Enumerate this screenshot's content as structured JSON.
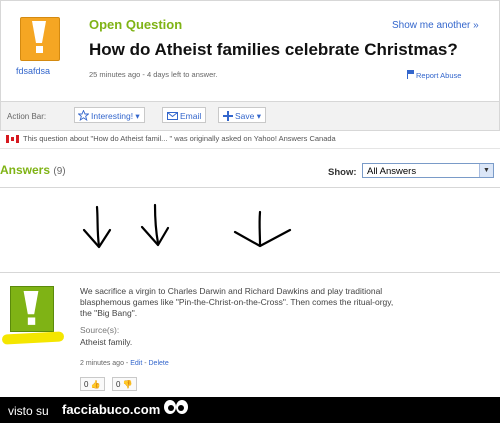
{
  "question": {
    "badge": "Open Question",
    "show_another": "Show me another »",
    "title": "How do Atheist families celebrate Christmas?",
    "meta": "25 minutes ago - 4 days left to answer.",
    "report": "Report Abuse",
    "username": "fdsafdsa"
  },
  "action_bar": {
    "label": "Action Bar:",
    "interesting": "Interesting! ▾",
    "email": "Email",
    "save": "Save ▾"
  },
  "notice": "This question about \"How do Atheist famil... \" was originally asked on Yahoo! Answers Canada",
  "answers": {
    "heading": "Answers",
    "count": "(9)",
    "show_label": "Show:",
    "filter_value": "All Answers"
  },
  "answer": {
    "line1": "We sacrifice a virgin to Charles Darwin and Richard Dawkins and play traditional",
    "line2": "blasphemous games like \"Pin-the-Christ-on-the-Cross\". Then comes the ritual-orgy,",
    "line3": "the \"Big Bang\".",
    "source_label": "Source(s):",
    "source_value": "Atheist family.",
    "time": "2 minutes ago - ",
    "edit": "Edit",
    "dash": " - ",
    "delete": "Delete",
    "thumbs_up": "0 👍",
    "thumbs_down": "0 👎"
  },
  "footer": {
    "visto": "visto su",
    "brand": "facciabuco.com"
  },
  "colors": {
    "green": "#7fb315",
    "link": "#3366cc",
    "orange": "#f5a623"
  }
}
